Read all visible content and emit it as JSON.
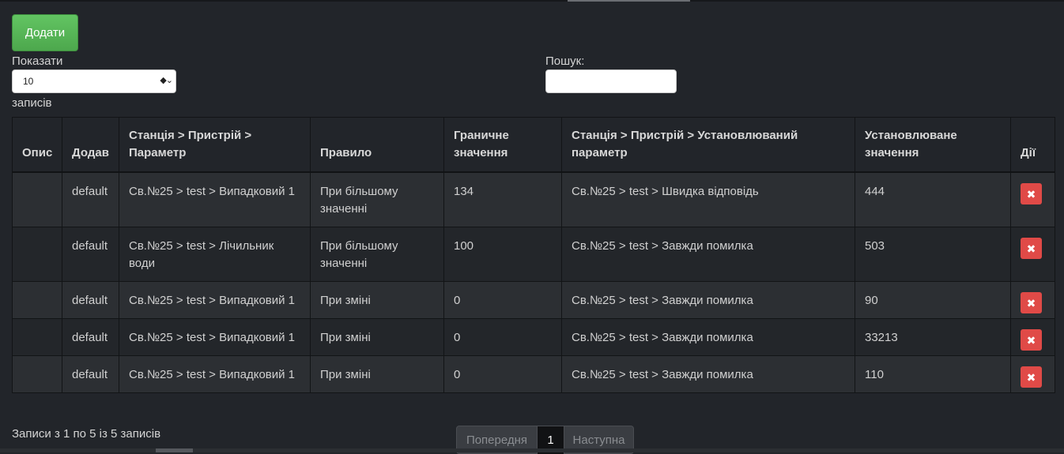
{
  "toolbar": {
    "add_label": "Додати"
  },
  "length": {
    "show_label": "Показати",
    "value": "10",
    "records_label": "записів"
  },
  "search": {
    "label": "Пошук:",
    "value": ""
  },
  "table": {
    "headers": [
      "Опис",
      "Додав",
      "Станція > Пристрій > Параметр",
      "Правило",
      "Граничне значення",
      "Станція > Пристрій > Установлюваний параметр",
      "Установлюване значення",
      "Дії"
    ],
    "rows": [
      {
        "desc": "",
        "added_by": "default",
        "param": "Св.№25 > test > Випадковий 1",
        "rule": "При більшому значенні",
        "limit": "134",
        "target_param": "Св.№25 > test > Швидка відповідь",
        "target_value": "444",
        "action": "delete"
      },
      {
        "desc": "",
        "added_by": "default",
        "param": "Св.№25 > test > Лічильник води",
        "rule": "При більшому значенні",
        "limit": "100",
        "target_param": "Св.№25 > test > Завжди помилка",
        "target_value": "503",
        "action": "delete"
      },
      {
        "desc": "",
        "added_by": "default",
        "param": "Св.№25 > test > Випадковий 1",
        "rule": "При зміні",
        "limit": "0",
        "target_param": "Св.№25 > test > Завжди помилка",
        "target_value": "90",
        "action": "delete"
      },
      {
        "desc": "",
        "added_by": "default",
        "param": "Св.№25 > test > Випадковий 1",
        "rule": "При зміні",
        "limit": "0",
        "target_param": "Св.№25 > test > Завжди помилка",
        "target_value": "33213",
        "action": "delete"
      },
      {
        "desc": "",
        "added_by": "default",
        "param": "Св.№25 > test > Випадковий 1",
        "rule": "При зміні",
        "limit": "0",
        "target_param": "Св.№25 > test > Завжди помилка",
        "target_value": "110",
        "action": "delete"
      }
    ]
  },
  "footer": {
    "info": "Записи з 1 по 5 із 5 записів"
  },
  "pagination": {
    "prev": "Попередня",
    "current": "1",
    "next": "Наступна"
  },
  "icons": {
    "select_arrow": "select-arrows-icon",
    "delete": "close-icon"
  },
  "colors": {
    "add_button": "#5cb85c",
    "delete_button": "#e04a47",
    "background": "#22252a"
  }
}
